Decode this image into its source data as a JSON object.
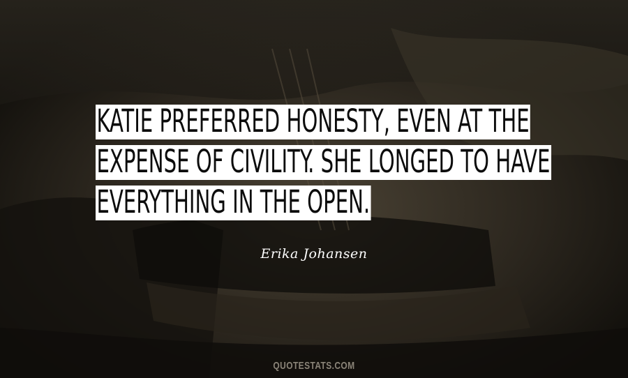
{
  "quote": {
    "lines": [
      "KATIE PREFERRED HONESTY, EVEN AT THE",
      "EXPENSE OF CIVILITY. SHE LONGED TO HAVE",
      "EVERYTHING IN THE OPEN."
    ]
  },
  "author": "Erika Johansen",
  "watermark": "QUOTESTATS.COM",
  "colors": {
    "background": "#1a1712",
    "quote_highlight": "#ffffff",
    "quote_text": "#0c0c0c",
    "author_text": "#ffffff",
    "watermark_text": "#8a8478"
  }
}
